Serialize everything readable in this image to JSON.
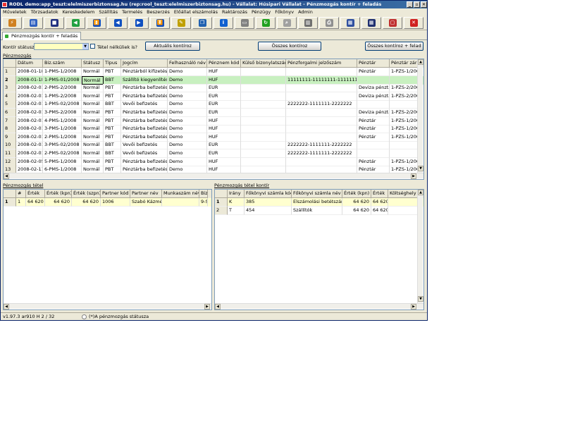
{
  "window": {
    "title": "RODL demo:app_teszt:elelmiszerbiztonsag.hu (rep:rool_teszt:elelmiszerbiztonsag.hu) - Vállalat: Húsipari Vállalat - Pénzmozgás kontír + feladás",
    "minimize": "_",
    "maximize": "▫",
    "close": "✕"
  },
  "menu": [
    "Műveletek",
    "Törzsadatok",
    "Kereskedelem",
    "Szállítás",
    "Termelés",
    "Beszerzés",
    "Előállat elszámolás",
    "Raktározás",
    "Pénzügy",
    "Főkönyv",
    "Admin"
  ],
  "toolbar": [
    {
      "icon": "lightning-icon",
      "glyph": "⚡",
      "color": "#d08020"
    },
    {
      "icon": "open-icon",
      "glyph": "▤",
      "color": "#3060c0"
    },
    {
      "icon": "save-icon",
      "glyph": "■",
      "color": "#203080"
    },
    {
      "icon": "undo-icon",
      "glyph": "◀",
      "color": "#20a040"
    },
    {
      "icon": "first-icon",
      "glyph": "⏫",
      "color": "#1050c0"
    },
    {
      "icon": "prev-icon",
      "glyph": "◀",
      "color": "#1050c0"
    },
    {
      "icon": "next-icon",
      "glyph": "▶",
      "color": "#1050c0"
    },
    {
      "icon": "last-icon",
      "glyph": "⏬",
      "color": "#1050c0"
    },
    {
      "icon": "edit-icon",
      "glyph": "✎",
      "color": "#c0a000"
    },
    {
      "icon": "copy-icon",
      "glyph": "❐",
      "color": "#2060b0"
    },
    {
      "icon": "info-icon",
      "glyph": "i",
      "color": "#1060d0"
    },
    {
      "icon": "form-icon",
      "glyph": "▭",
      "color": "#808080"
    },
    {
      "icon": "refresh-icon",
      "glyph": "↻",
      "color": "#20a020"
    },
    {
      "icon": "search-icon",
      "glyph": "⌕",
      "color": "#a0a0a0"
    },
    {
      "icon": "columns-icon",
      "glyph": "▥",
      "color": "#707070"
    },
    {
      "icon": "print-icon",
      "glyph": "⎙",
      "color": "#909090"
    },
    {
      "icon": "grid-icon",
      "glyph": "▦",
      "color": "#3050a0"
    },
    {
      "icon": "table-icon",
      "glyph": "▦",
      "color": "#203070"
    },
    {
      "icon": "window-icon",
      "glyph": "▢",
      "color": "#c03030"
    },
    {
      "icon": "exit-icon",
      "glyph": "✕",
      "color": "#d02020"
    }
  ],
  "tab": {
    "label": "Pénzmozgás kontír + feladás"
  },
  "filter": {
    "status_label": "Kontír státusz:",
    "checkbox_label": "Tétel nélküliek is?",
    "btn_current": "Aktuális kontíroz",
    "btn_all": "Összes kontíroz",
    "btn_all_post": "Összes kontíroz + felad"
  },
  "section_top": "Pénzmozgás",
  "top_grid": {
    "headers": [
      "Dátum",
      "Biz.szám",
      "Státusz",
      "Típus",
      "Jogcím",
      "Felhasználó név",
      "Pénznem kód",
      "Külső bizonylatszám",
      "Pénzforgalmi jelzőszám",
      "Pénztár",
      "Pénztár zárás"
    ],
    "rows": [
      [
        "1",
        "2008-01-18",
        "1-PMS-1/2008",
        "Normál",
        "PBT",
        "Pénztárból kifizetés",
        "Demo",
        "HUF",
        "",
        "",
        "Pénztár",
        "1-PZS-1/2008"
      ],
      [
        "2",
        "2008-01-18",
        "1-PMS-01/2008",
        "Normál",
        "BBT",
        "Szállító kiegyenlítése",
        "Demo",
        "HUF",
        "",
        "11111111-11111111-11111111",
        "",
        ""
      ],
      [
        "3",
        "2008-02-01",
        "2-PMS-2/2008",
        "Normál",
        "PBT",
        "Pénztárba befizetés",
        "Demo",
        "EUR",
        "",
        "",
        "Deviza pénztár",
        "1-PZS-2/2008"
      ],
      [
        "4",
        "2008-02-01",
        "1-PMS-2/2008",
        "Normál",
        "PBT",
        "Pénztárba befizetés",
        "Demo",
        "EUR",
        "",
        "",
        "Deviza pénztár",
        "1-PZS-2/2008"
      ],
      [
        "5",
        "2008-02-01",
        "1-PMS-02/2008",
        "Normál",
        "BBT",
        "Vevői befizetés",
        "Demo",
        "EUR",
        "",
        "2222222-1111111-2222222",
        "",
        ""
      ],
      [
        "6",
        "2008-02-01",
        "3-PMS-2/2008",
        "Normál",
        "PBT",
        "Pénztárba befizetés",
        "Demo",
        "EUR",
        "",
        "",
        "Deviza pénztár",
        "1-PZS-2/2008"
      ],
      [
        "7",
        "2008-02-01",
        "4-PMS-1/2008",
        "Normál",
        "PBT",
        "Pénztárba befizetés",
        "Demo",
        "HUF",
        "",
        "",
        "Pénztár",
        "1-PZS-1/2008"
      ],
      [
        "8",
        "2008-02-01",
        "3-PMS-1/2008",
        "Normál",
        "PBT",
        "Pénztárba befizetés",
        "Demo",
        "HUF",
        "",
        "",
        "Pénztár",
        "1-PZS-1/2008"
      ],
      [
        "9",
        "2008-02-01",
        "2-PMS-1/2008",
        "Normál",
        "PBT",
        "Pénztárba befizetés",
        "Demo",
        "HUF",
        "",
        "",
        "Pénztár",
        "1-PZS-1/2008"
      ],
      [
        "10",
        "2008-02-01",
        "3-PMS-02/2008",
        "Normál",
        "BBT",
        "Vevői befizetés",
        "Demo",
        "EUR",
        "",
        "2222222-1111111-2222222",
        "",
        ""
      ],
      [
        "11",
        "2008-02-01",
        "2-PMS-02/2008",
        "Normál",
        "BBT",
        "Vevői befizetés",
        "Demo",
        "EUR",
        "",
        "2222222-1111111-2222222",
        "",
        ""
      ],
      [
        "12",
        "2008-02-05",
        "5-PMS-1/2008",
        "Normál",
        "PBT",
        "Pénztárba befizetés",
        "Demo",
        "HUF",
        "",
        "",
        "Pénztár",
        "1-PZS-1/2008"
      ],
      [
        "13",
        "2008-02-11",
        "6-PMS-1/2008",
        "Normál",
        "PBT",
        "Pénztárba befizetés",
        "Demo",
        "HUF",
        "",
        "",
        "Pénztár",
        "1-PZS-1/2008"
      ]
    ]
  },
  "section_left": "Pénzmozgás tétel",
  "left_grid": {
    "headers": [
      "#",
      "Érték",
      "Érték (kpn)",
      "Érték (szpn)",
      "Partner kód",
      "Partner név",
      "Munkaszám név",
      "Biz"
    ],
    "rows": [
      [
        "1",
        "1",
        "64 620",
        "64 620",
        "64 620",
        "1006",
        "Szabó Kázmér",
        "",
        "9-S"
      ]
    ]
  },
  "section_right": "Pénzmozgás tétel kontír",
  "right_grid": {
    "headers": [
      "Irány",
      "Főkönyvi számla kód",
      "Főkönyvi számla név",
      "Érték (kpn)",
      "Érték",
      "Költséghely kód"
    ],
    "rows": [
      [
        "1",
        "K",
        "385",
        "Elszámolási betétszámla",
        "64 620",
        "64 620",
        ""
      ],
      [
        "2",
        "T",
        "454",
        "Szállítók",
        "64 620",
        "64 620",
        ""
      ]
    ]
  },
  "status": {
    "version": "v1.97.3 ar910 H 2 / 32",
    "radio_label": "(*)A pénzmozgás státusza"
  },
  "colors": {
    "selected_row": "#c8f0c0",
    "highlight_row": "#ffffd0",
    "focus": "#000000"
  }
}
